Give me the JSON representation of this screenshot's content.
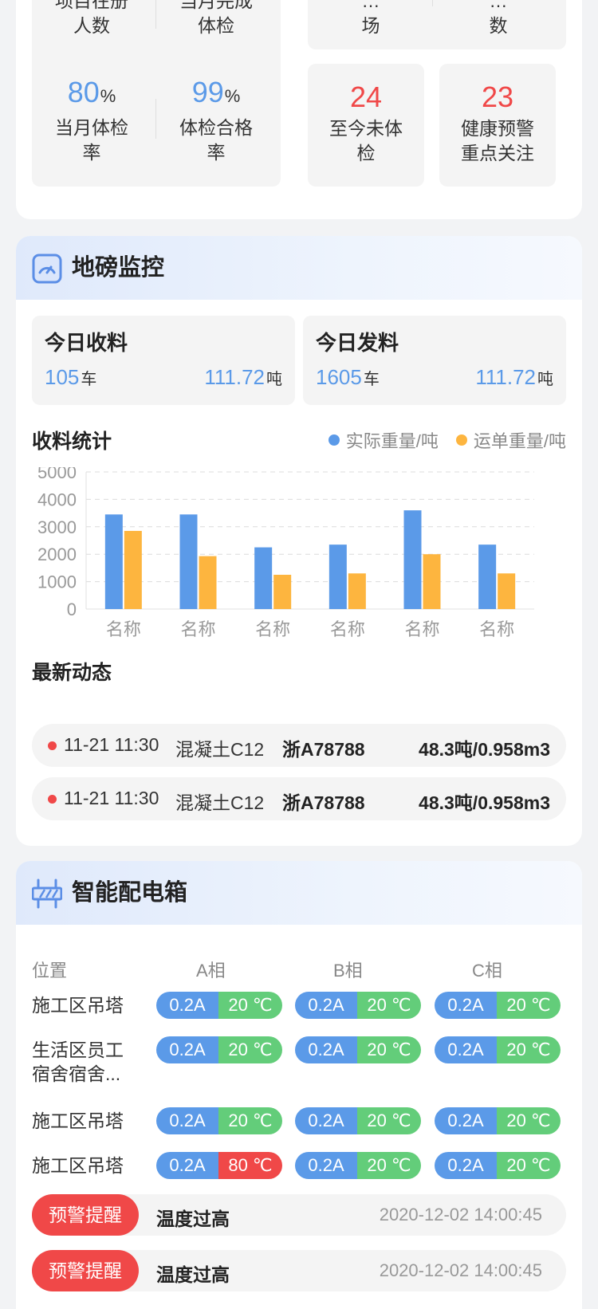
{
  "health": {
    "stats_left_top": [
      {
        "label_line1": "项目在册",
        "label_line2": "人数"
      },
      {
        "label_line1": "当月完成",
        "label_line2": "体检"
      }
    ],
    "stats_left_bottom": [
      {
        "value": "80",
        "unit": "%",
        "label_line1": "当月体检",
        "label_line2": "率"
      },
      {
        "value": "99",
        "unit": "%",
        "label_line1": "体检合格",
        "label_line2": "率"
      }
    ],
    "stats_right_top": [
      {
        "label_line1": "…",
        "label_line2": "场"
      },
      {
        "label_line1": "…",
        "label_line2": "数"
      }
    ],
    "stats_right_bottom": [
      {
        "value": "24",
        "label_line1": "至今未体",
        "label_line2": "检"
      },
      {
        "value": "23",
        "label_line1": "健康预警",
        "label_line2": "重点关注"
      }
    ]
  },
  "weigh": {
    "title": "地磅监控",
    "receive": {
      "title": "今日收料",
      "count": "105",
      "count_unit": "车",
      "weight": "111.72",
      "weight_unit": "吨"
    },
    "send": {
      "title": "今日发料",
      "count": "1605",
      "count_unit": "车",
      "weight": "111.72",
      "weight_unit": "吨"
    },
    "stats_title": "收料统计",
    "legend": {
      "actual": "实际重量/吨",
      "waybill": "运单重量/吨"
    },
    "colors": {
      "actual": "#5b9ae8",
      "waybill": "#fdb53f"
    },
    "latest_title": "最新动态",
    "feed": [
      {
        "time": "11-21 11:30",
        "material": "混凝土C12",
        "plate": "浙A78788",
        "weight": "48.3吨/0.958m3"
      },
      {
        "time": "11-21 11:30",
        "material": "混凝土C12",
        "plate": "浙A78788",
        "weight": "48.3吨/0.958m3"
      }
    ]
  },
  "chart_data": {
    "type": "bar",
    "categories": [
      "名称",
      "名称",
      "名称",
      "名称",
      "名称",
      "名称"
    ],
    "series": [
      {
        "name": "实际重量/吨",
        "values": [
          3450,
          3450,
          2250,
          2350,
          3600,
          2350
        ]
      },
      {
        "name": "运单重量/吨",
        "values": [
          2850,
          1930,
          1250,
          1300,
          2000,
          1300
        ]
      }
    ],
    "ylim": [
      0,
      5000
    ],
    "yticks": [
      0,
      1000,
      2000,
      3000,
      4000,
      5000
    ],
    "title": "收料统计",
    "xlabel": "",
    "ylabel": ""
  },
  "box": {
    "title": "智能配电箱",
    "headers": {
      "position": "位置",
      "a": "A相",
      "b": "B相",
      "c": "C相"
    },
    "rows": [
      {
        "label_line1": "施工区吊塔",
        "label_line2": "",
        "a_cur": "0.2A",
        "a_tmp": "20 ℃",
        "b_cur": "0.2A",
        "b_tmp": "20 ℃",
        "c_cur": "0.2A",
        "c_tmp": "20 ℃"
      },
      {
        "label_line1": "生活区员工",
        "label_line2": "宿舍宿舍...",
        "a_cur": "0.2A",
        "a_tmp": "20 ℃",
        "b_cur": "0.2A",
        "b_tmp": "20 ℃",
        "c_cur": "0.2A",
        "c_tmp": "20 ℃"
      },
      {
        "label_line1": "施工区吊塔",
        "label_line2": "",
        "a_cur": "0.2A",
        "a_tmp": "20 ℃",
        "b_cur": "0.2A",
        "b_tmp": "20 ℃",
        "c_cur": "0.2A",
        "c_tmp": "20 ℃"
      },
      {
        "label_line1": "施工区吊塔",
        "label_line2": "",
        "a_cur": "0.2A",
        "a_tmp": "80 ℃",
        "b_cur": "0.2A",
        "b_tmp": "20 ℃",
        "c_cur": "0.2A",
        "c_tmp": "20 ℃"
      }
    ],
    "alerts": [
      {
        "tag": "预警提醒",
        "message": "温度过高",
        "time": "2020-12-02 14:00:45"
      },
      {
        "tag": "预警提醒",
        "message": "温度过高",
        "time": "2020-12-02 14:00:45"
      }
    ]
  }
}
